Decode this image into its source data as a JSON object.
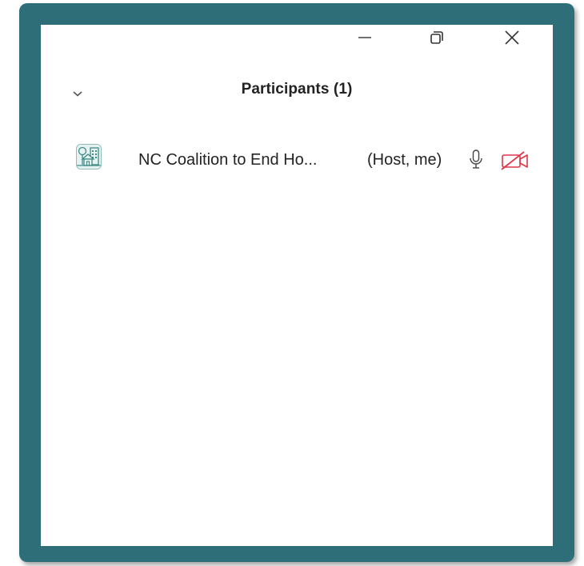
{
  "window": {
    "controls": {
      "minimize_icon": "minimize-icon",
      "restore_icon": "restore-icon",
      "close_icon": "close-icon"
    }
  },
  "panel": {
    "title": "Participants (1)",
    "collapse_icon": "chevron-down-icon"
  },
  "participants": [
    {
      "name": "NC Coalition to End Ho...",
      "role": "(Host, me)",
      "avatar_icon": "organization-avatar-icon",
      "mic_icon": "microphone-icon",
      "video_icon": "video-off-icon"
    }
  ],
  "colors": {
    "frame": "#2e6e79",
    "video_off": "#e0364a",
    "avatar_accent": "#3f8a84"
  }
}
